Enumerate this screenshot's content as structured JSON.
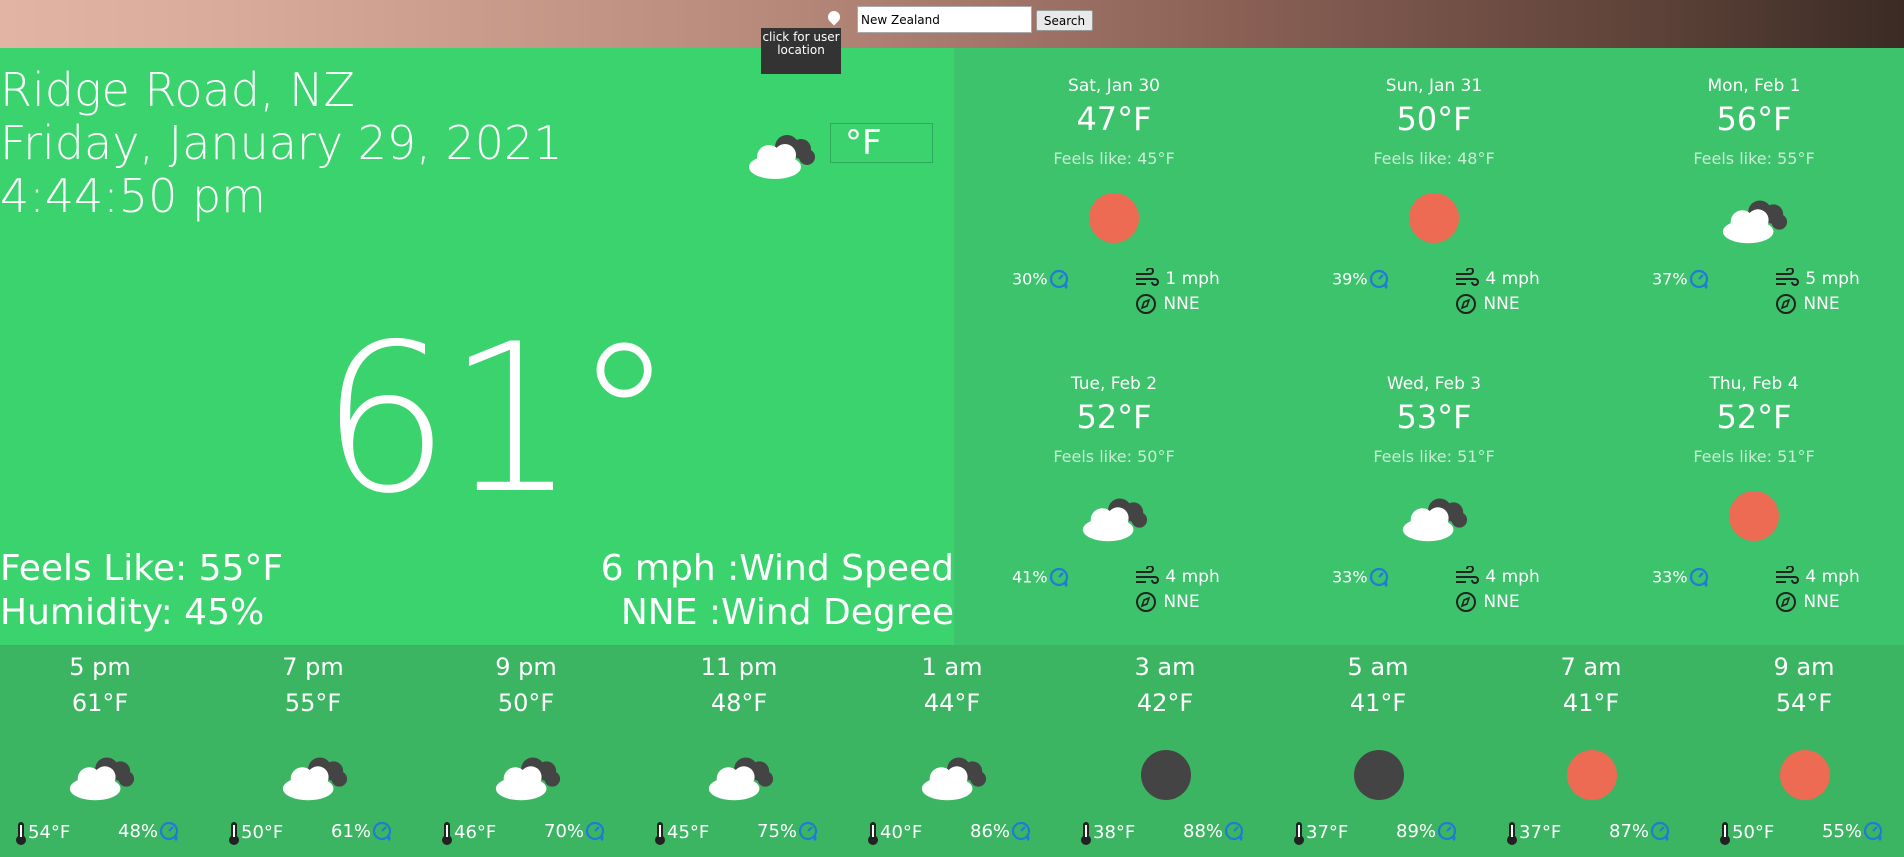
{
  "header": {
    "location_tooltip": "click for user location",
    "search_value": "New Zealand",
    "search_label": "Search"
  },
  "current": {
    "location": "Ridge Road, NZ",
    "date": "Friday, January 29, 2021",
    "time": "4:44:50 pm",
    "unit": "°F",
    "temperature": "61°",
    "feels_like": "Feels Like: 55°F",
    "humidity": "Humidity: 45%",
    "wind_speed": "6 mph :Wind Speed",
    "wind_degree": "NNE :Wind Degree",
    "icon": "cloudy-icon"
  },
  "daily": [
    {
      "day": "Sat, Jan 30",
      "temp": "47°F",
      "feels": "Feels like: 45°F",
      "icon": "sun",
      "humidity": "30%",
      "wind": "1 mph",
      "dir": "NNE"
    },
    {
      "day": "Sun, Jan 31",
      "temp": "50°F",
      "feels": "Feels like: 48°F",
      "icon": "sun",
      "humidity": "39%",
      "wind": "4 mph",
      "dir": "NNE"
    },
    {
      "day": "Mon, Feb 1",
      "temp": "56°F",
      "feels": "Feels like: 55°F",
      "icon": "cloud",
      "humidity": "37%",
      "wind": "5 mph",
      "dir": "NNE"
    },
    {
      "day": "Tue, Feb 2",
      "temp": "52°F",
      "feels": "Feels like: 50°F",
      "icon": "cloud",
      "humidity": "41%",
      "wind": "4 mph",
      "dir": "NNE"
    },
    {
      "day": "Wed, Feb 3",
      "temp": "53°F",
      "feels": "Feels like: 51°F",
      "icon": "cloud",
      "humidity": "33%",
      "wind": "4 mph",
      "dir": "NNE"
    },
    {
      "day": "Thu, Feb 4",
      "temp": "52°F",
      "feels": "Feels like: 51°F",
      "icon": "sun",
      "humidity": "33%",
      "wind": "4 mph",
      "dir": "NNE"
    }
  ],
  "hourly": [
    {
      "time": "5 pm",
      "temp": "61°F",
      "icon": "cloud",
      "feels": "54°F",
      "humidity": "48%"
    },
    {
      "time": "7 pm",
      "temp": "55°F",
      "icon": "cloud",
      "feels": "50°F",
      "humidity": "61%"
    },
    {
      "time": "9 pm",
      "temp": "50°F",
      "icon": "cloud",
      "feels": "46°F",
      "humidity": "70%"
    },
    {
      "time": "11 pm",
      "temp": "48°F",
      "icon": "cloud",
      "feels": "45°F",
      "humidity": "75%"
    },
    {
      "time": "1 am",
      "temp": "44°F",
      "icon": "cloud",
      "feels": "40°F",
      "humidity": "86%"
    },
    {
      "time": "3 am",
      "temp": "42°F",
      "icon": "moon",
      "feels": "38°F",
      "humidity": "88%"
    },
    {
      "time": "5 am",
      "temp": "41°F",
      "icon": "moon",
      "feels": "37°F",
      "humidity": "89%"
    },
    {
      "time": "7 am",
      "temp": "41°F",
      "icon": "sun",
      "feels": "37°F",
      "humidity": "87%"
    },
    {
      "time": "9 am",
      "temp": "54°F",
      "icon": "sun",
      "feels": "50°F",
      "humidity": "55%"
    }
  ],
  "colors": {
    "sun": "#ec6b52",
    "moon": "#444444",
    "humidity_icon": "#1f7bd6"
  }
}
